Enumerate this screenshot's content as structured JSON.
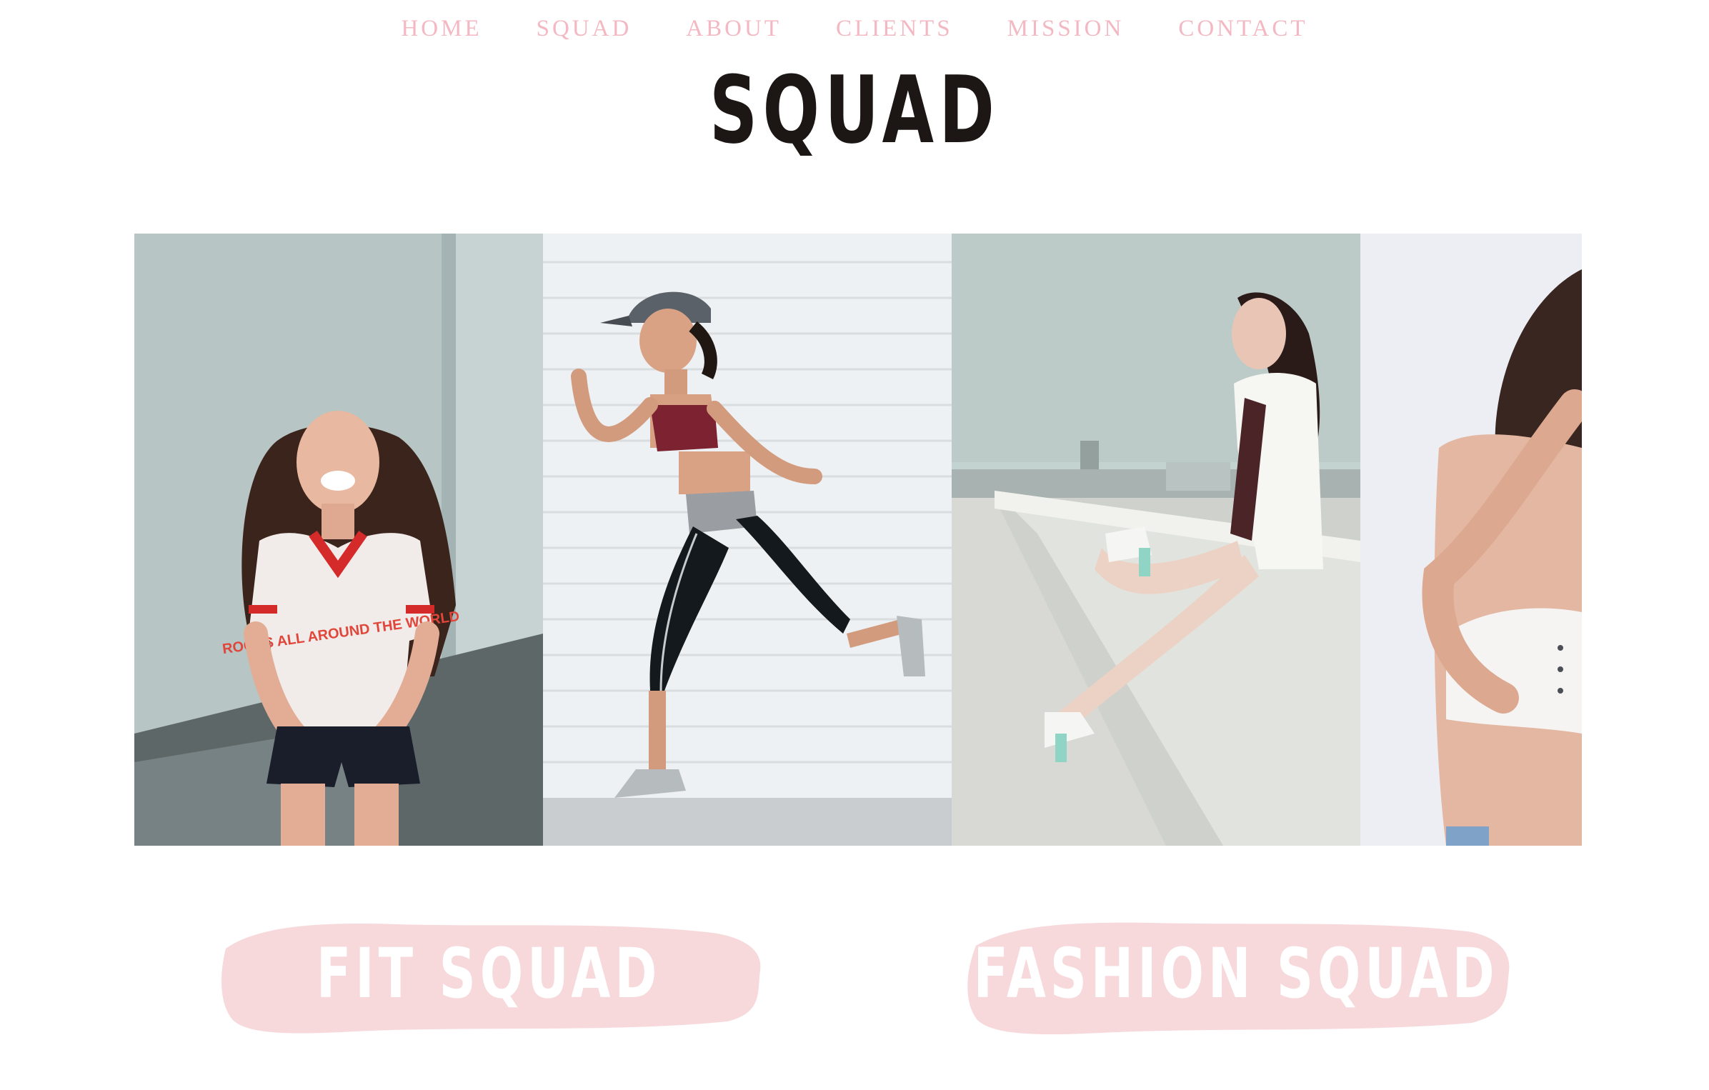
{
  "nav": {
    "items": [
      {
        "label": "HOME"
      },
      {
        "label": "SQUAD"
      },
      {
        "label": "ABOUT"
      },
      {
        "label": "CLIENTS"
      },
      {
        "label": "MISSION"
      },
      {
        "label": "CONTACT"
      }
    ]
  },
  "page": {
    "title": "SQUAD"
  },
  "gallery": {
    "photos": [
      {
        "subject": "laughing woman in red and white t-shirt against grey wall"
      },
      {
        "subject": "runner in cap, sports bra and leggings against white brick wall"
      },
      {
        "subject": "woman in white blazer sitting on rooftop ledge above city"
      },
      {
        "subject": "woman in white crop top, partially visible"
      }
    ],
    "shirt_text": "ROCKS ALL AROUND THE WORLD"
  },
  "squads": {
    "fit_label": "FIT SQUAD",
    "fashion_label": "FASHION SQUAD"
  },
  "colors": {
    "nav_pink": "#f3b8c2",
    "title": "#1c1614",
    "brush_pink": "#f7d9dc"
  }
}
